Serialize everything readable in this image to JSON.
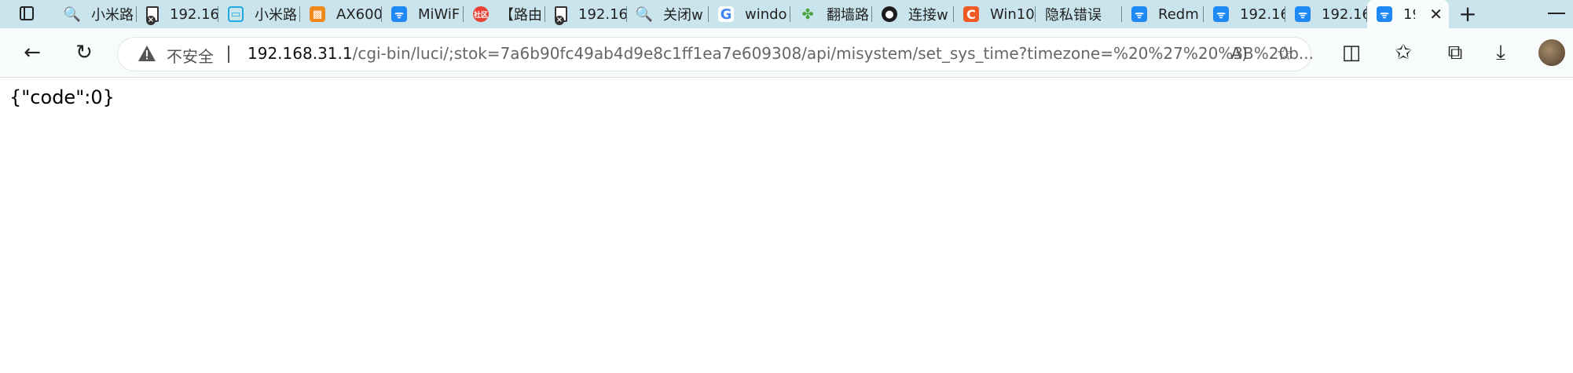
{
  "tabs": [
    {
      "title": "小米路",
      "icon": "search-icon",
      "fav_text": "🔍"
    },
    {
      "title": "192.16",
      "icon": "page-error-icon",
      "fav_text": ""
    },
    {
      "title": "小米路",
      "icon": "bilibili-tv-icon",
      "fav_text": "▭"
    },
    {
      "title": "AX600",
      "icon": "orange-logo-icon",
      "fav_text": "▩"
    },
    {
      "title": "MiWiF",
      "icon": "wifi-icon",
      "fav_text": "ᯤ"
    },
    {
      "title": "【路由",
      "icon": "community-logo-icon",
      "fav_text": "社区"
    },
    {
      "title": "192.16",
      "icon": "page-error-icon",
      "fav_text": ""
    },
    {
      "title": "关闭w",
      "icon": "search-icon",
      "fav_text": "🔍"
    },
    {
      "title": "windo",
      "icon": "google-icon",
      "fav_text": "G"
    },
    {
      "title": "翻墙路",
      "icon": "clover-icon",
      "fav_text": "✤"
    },
    {
      "title": "连接w",
      "icon": "github-icon",
      "fav_text": "●"
    },
    {
      "title": "Win10",
      "icon": "c-logo-icon",
      "fav_text": "C"
    },
    {
      "title": "隐私错误",
      "icon": "none",
      "fav_text": ""
    },
    {
      "title": "Redm",
      "icon": "wifi-icon",
      "fav_text": "ᯤ"
    },
    {
      "title": "192.16",
      "icon": "wifi-icon",
      "fav_text": "ᯤ"
    },
    {
      "title": "192.16",
      "icon": "wifi-icon",
      "fav_text": "ᯤ"
    },
    {
      "title": "19",
      "icon": "wifi-icon",
      "fav_text": "ᯤ",
      "active": true
    }
  ],
  "toolbar": {
    "back_glyph": "←",
    "refresh_glyph": "↻",
    "security_label": "不安全",
    "url_host": "192.168.31.1",
    "url_rest": "/cgi-bin/luci/;stok=7a6b90fc49ab4d9e8c1ff1ea7e609308/api/misystem/set_sys_time?timezone=%20%27%20%3B%20b...",
    "read_aloud_glyph": "A)",
    "add_favorite_glyph": "☆",
    "split_screen_glyph": "◫",
    "favorites_glyph": "✩",
    "collections_glyph": "⧉",
    "downloads_glyph": "⤓"
  },
  "window": {
    "new_tab_glyph": "+",
    "close_tab_glyph": "✕"
  },
  "page": {
    "body_text": "{\"code\":0}"
  }
}
